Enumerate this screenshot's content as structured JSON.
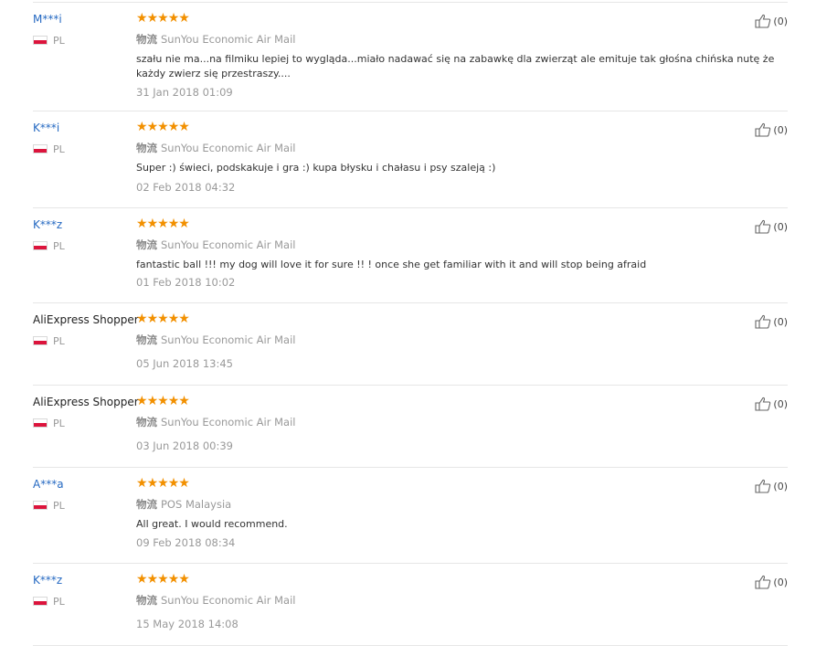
{
  "logistics_label": "物流",
  "like_count": "(0)",
  "reviews": [
    {
      "name": "M***i",
      "country": "PL",
      "stars": 5,
      "logistics": "SunYou Economic Air Mail",
      "text": "szału nie ma...na filmiku lepiej to wygląda...miało nadawać się na zabawkę dla zwierząt ale emituje tak głośna chińska nutę że każdy zwierz się przestraszy....",
      "date": "31 Jan 2018 01:09"
    },
    {
      "name": "K***i",
      "country": "PL",
      "stars": 5,
      "logistics": "SunYou Economic Air Mail",
      "text": "Super :) świeci, podskakuje i gra :) kupa błysku i chałasu i psy szaleją :)",
      "date": "02 Feb 2018 04:32"
    },
    {
      "name": "K***z",
      "country": "PL",
      "stars": 5,
      "logistics": "SunYou Economic Air Mail",
      "text": "fantastic ball !!! my dog will love it for sure !! ! once she get familiar with it and will stop being afraid",
      "date": "01 Feb 2018 10:02"
    },
    {
      "name": "AliExpress Shopper",
      "country": "PL",
      "stars": 5,
      "logistics": "SunYou Economic Air Mail",
      "text": "",
      "date": "05 Jun 2018 13:45"
    },
    {
      "name": "AliExpress Shopper",
      "country": "PL",
      "stars": 5,
      "logistics": "SunYou Economic Air Mail",
      "text": "",
      "date": "03 Jun 2018 00:39"
    },
    {
      "name": "A***a",
      "country": "PL",
      "stars": 5,
      "logistics": "POS Malaysia",
      "text": "All great. I would recommend.",
      "date": "09 Feb 2018 08:34"
    },
    {
      "name": "K***z",
      "country": "PL",
      "stars": 5,
      "logistics": "SunYou Economic Air Mail",
      "text": "",
      "date": "15 May 2018 14:08"
    }
  ]
}
